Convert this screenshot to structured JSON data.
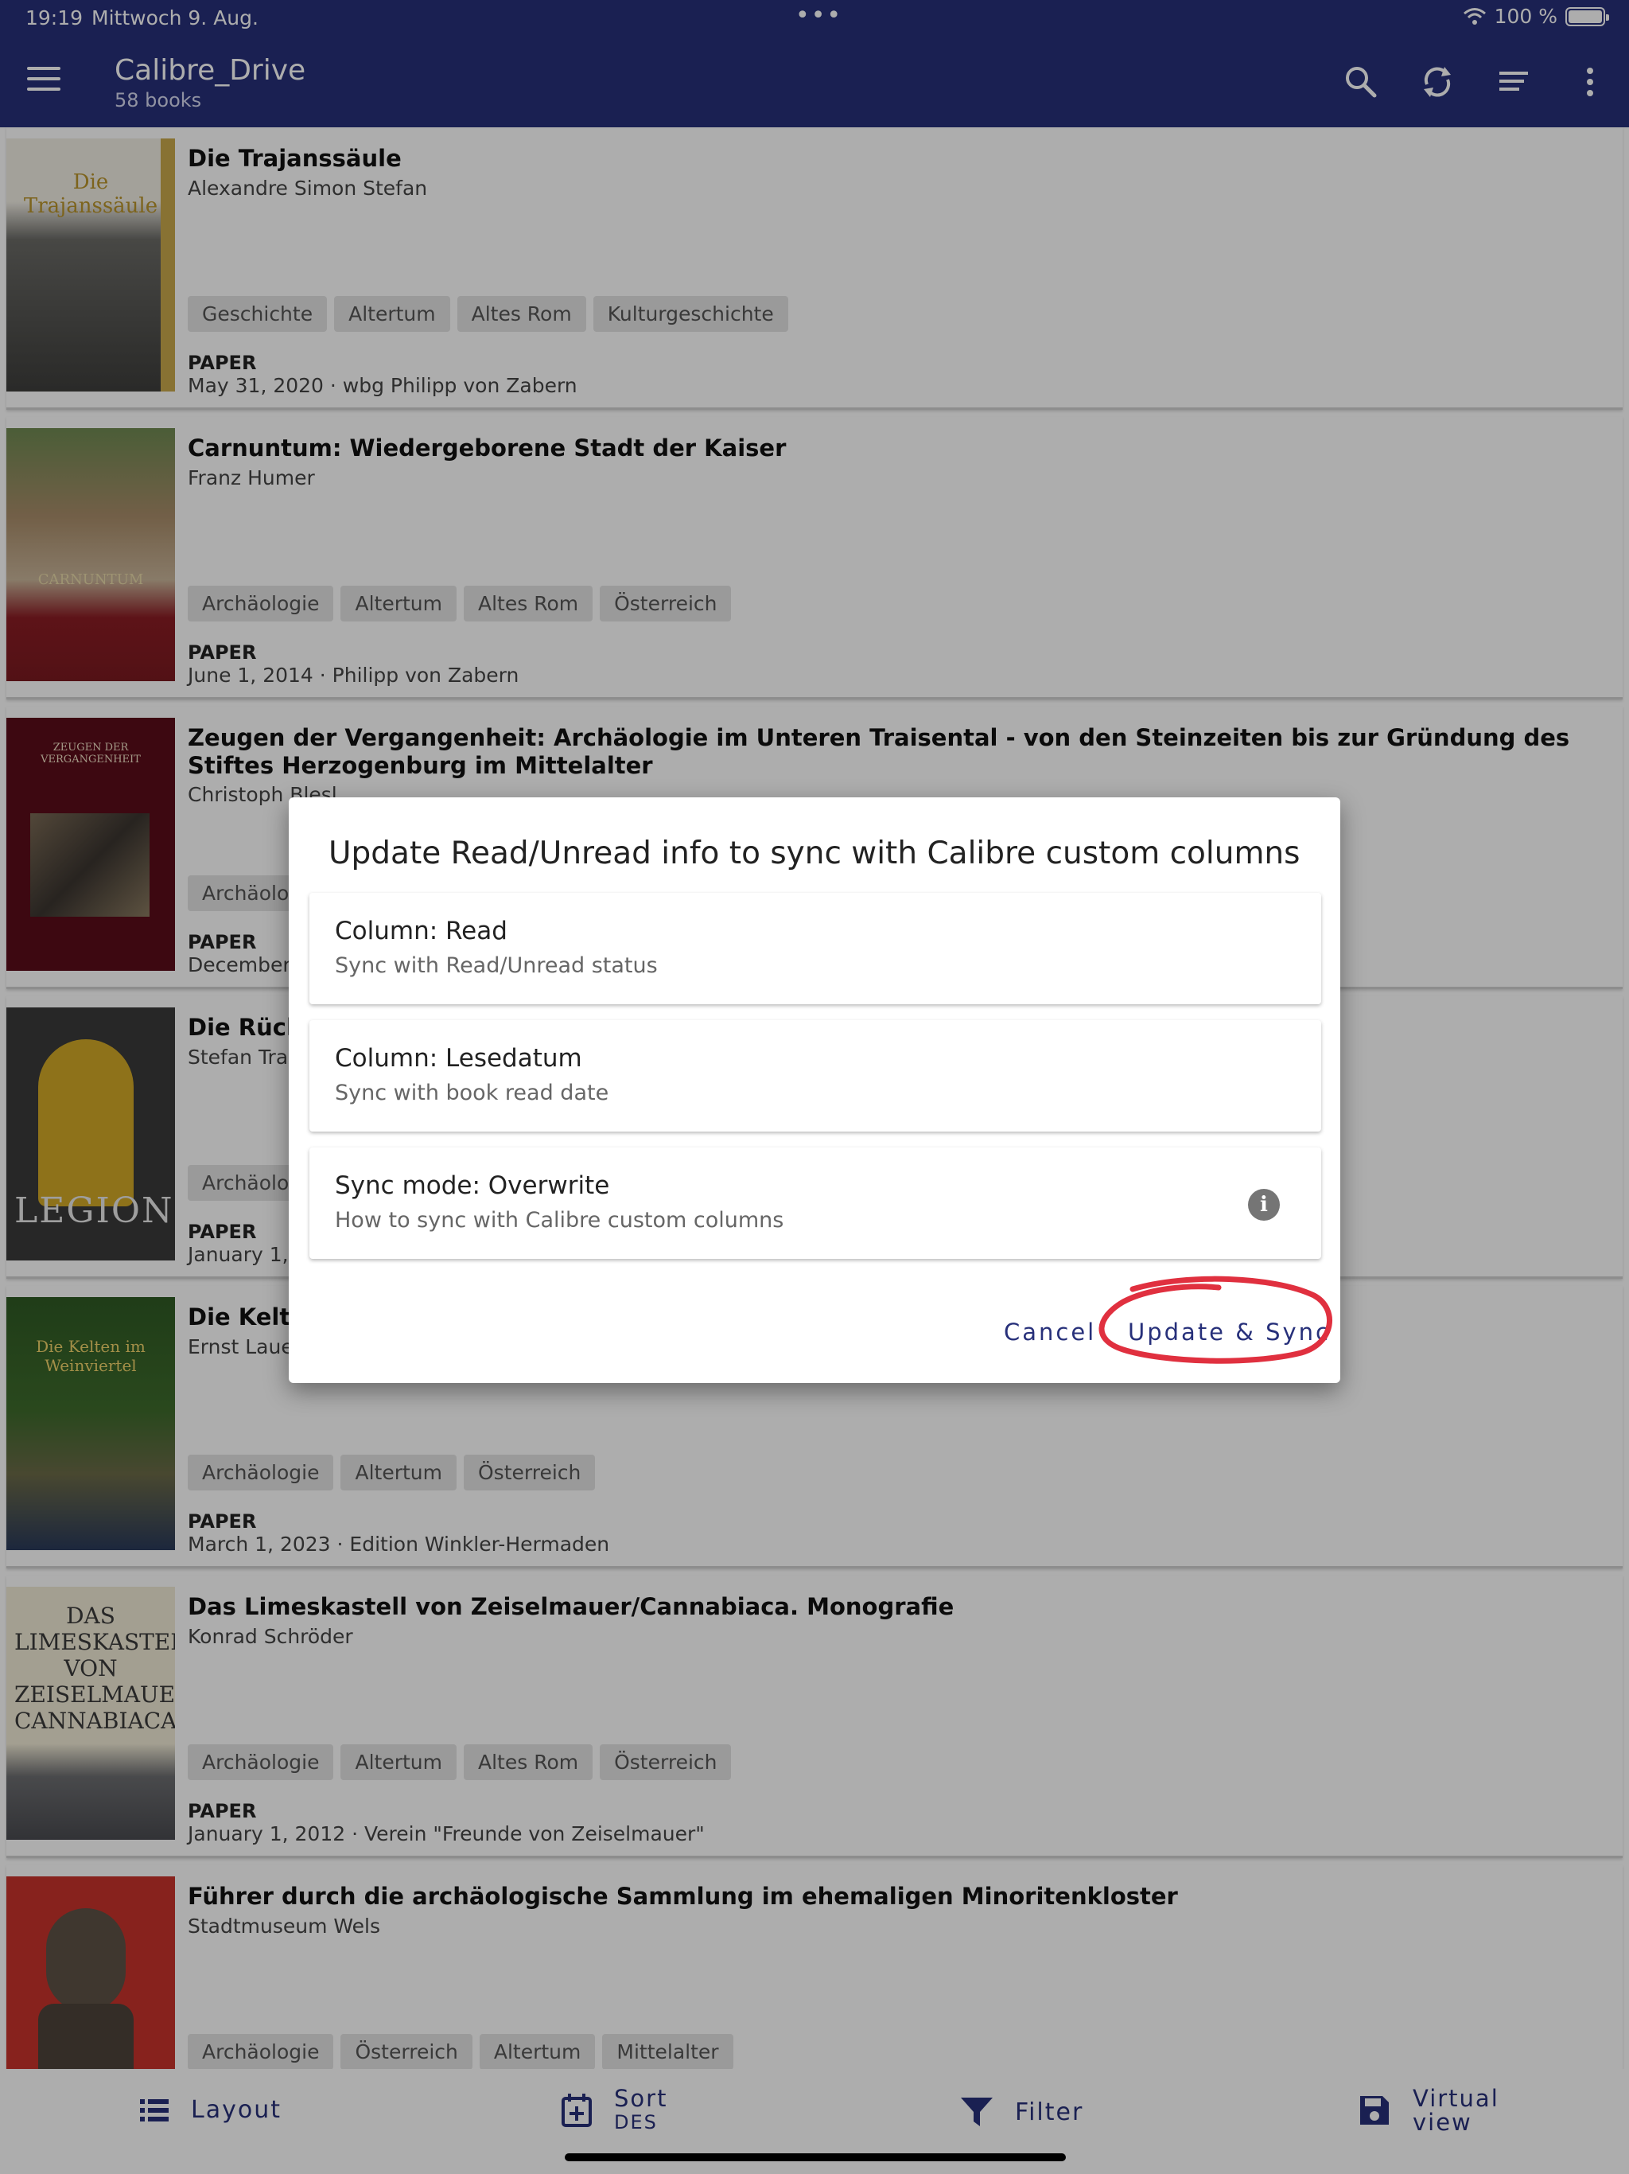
{
  "status": {
    "time": "19:19",
    "date": "Mittwoch 9. Aug.",
    "dots": "•••",
    "battery": "100 %"
  },
  "appbar": {
    "title": "Calibre_Drive",
    "subtitle": "58 books"
  },
  "books": [
    {
      "title": "Die Trajanssäule",
      "author": "Alexandre Simon Stefan",
      "tags": [
        "Geschichte",
        "Altertum",
        "Altes Rom",
        "Kulturgeschichte"
      ],
      "format": "PAPER",
      "meta": "May 31, 2020 · wbg Philipp von Zabern",
      "cover_text": "Die Trajanssäule"
    },
    {
      "title": "Carnuntum: Wiedergeborene Stadt der Kaiser",
      "author": "Franz Humer",
      "tags": [
        "Archäologie",
        "Altertum",
        "Altes Rom",
        "Österreich"
      ],
      "format": "PAPER",
      "meta": "June 1, 2014 · Philipp von Zabern",
      "cover_text": "CARNUNTUM"
    },
    {
      "title": "Zeugen der Vergangenheit: Archäologie im Unteren Traisental - von den Steinzeiten bis zur Gründung des Stiftes Herzogenburg im Mittelalter",
      "author": "Christoph Blesl",
      "tags": [
        "Archäologie"
      ],
      "format": "PAPER",
      "meta": "December",
      "cover_text": "ZEUGEN DER VERGANGENHEIT"
    },
    {
      "title": "Die Rück",
      "author": "Stefan Trax",
      "tags": [
        "Archäologie"
      ],
      "format": "PAPER",
      "meta": "January 1,",
      "cover_text": "LEGION"
    },
    {
      "title": "Die Kelte",
      "author": "Ernst Lauer",
      "tags": [
        "Archäologie",
        "Altertum",
        "Österreich"
      ],
      "format": "PAPER",
      "meta": "March 1, 2023 · Edition Winkler-Hermaden",
      "cover_text": "Die Kelten im Weinviertel"
    },
    {
      "title": "Das Limeskastell von Zeiselmauer/Cannabiaca. Monografie",
      "author": "Konrad Schröder",
      "tags": [
        "Archäologie",
        "Altertum",
        "Altes Rom",
        "Österreich"
      ],
      "format": "PAPER",
      "meta": "January 1, 2012 · Verein \"Freunde von Zeiselmauer\"",
      "cover_text": "DAS LIMESKASTELL VON ZEISELMAUER CANNABIACA"
    },
    {
      "title": "Führer durch die archäologische Sammlung im ehemaligen Minoritenkloster",
      "author": "Stadtmuseum Wels",
      "tags": [
        "Archäologie",
        "Österreich",
        "Altertum",
        "Mittelalter"
      ],
      "format": "",
      "meta": "",
      "cover_text": ""
    }
  ],
  "dialog": {
    "title": "Update Read/Unread info to sync with Calibre custom columns",
    "options": [
      {
        "title": "Column: Read",
        "subtitle": "Sync with Read/Unread status"
      },
      {
        "title": "Column: Lesedatum",
        "subtitle": "Sync with book read date"
      },
      {
        "title": "Sync mode: Overwrite",
        "subtitle": "How to sync with Calibre custom columns"
      }
    ],
    "info_glyph": "i",
    "cancel": "Cancel",
    "confirm": "Update & Sync"
  },
  "bottomnav": {
    "layout": "Layout",
    "sort": "Sort",
    "sort_sub": "DES",
    "filter": "Filter",
    "virtual_line1": "Virtual",
    "virtual_line2": "view"
  },
  "colors": {
    "primary": "#27307a",
    "annotation": "#e0303f"
  }
}
